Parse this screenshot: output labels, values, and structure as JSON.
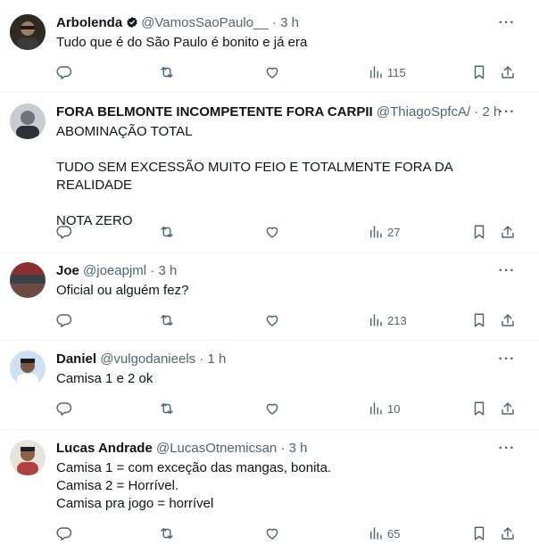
{
  "feed": {
    "tweets": [
      {
        "name": "Arbolenda",
        "verified": true,
        "handle": "@VamosSaoPaulo__",
        "separator": "·",
        "time": "3 h",
        "text": "Tudo que é do São Paulo é bonito e já era",
        "views": "115",
        "avatar_color": "#2f2a24"
      },
      {
        "name": "FORA BELMONTE INCOMPETENTE FORA CARPII",
        "verified": false,
        "handle": "@ThiagoSpfcA/",
        "separator": "·",
        "time": "2 h",
        "text": "ABOMINAÇÃO TOTAL\n\nTUDO SEM EXCESSÃO MUITO FEIO E TOTALMENTE FORA DA REALIDADE\n\nNOTA ZERO",
        "views": "27",
        "avatar_color": "#8a8f96"
      },
      {
        "name": "Joe",
        "verified": false,
        "handle": "@joeapjml",
        "separator": "·",
        "time": "3 h",
        "text": "Oficial ou alguém fez?",
        "views": "213",
        "avatar_color": "#6b4a44"
      },
      {
        "name": "Daniel",
        "verified": false,
        "handle": "@vulgodanieels",
        "separator": "·",
        "time": "1 h",
        "text": "Camisa 1 e 2 ok",
        "views": "10",
        "avatar_color": "#5a7fa8"
      },
      {
        "name": "Lucas Andrade",
        "verified": false,
        "handle": "@LucasOtnemicsan",
        "separator": "·",
        "time": "3 h",
        "text": "Camisa 1 = com exceção das mangas, bonita.\nCamisa 2 = Horrível.\nCamisa pra jogo = horrível",
        "views": "65",
        "avatar_color": "#b0413e"
      }
    ]
  },
  "icons": {
    "more": "more-icon",
    "reply": "reply-icon",
    "retweet": "retweet-icon",
    "like": "heart-icon",
    "views": "views-icon",
    "bookmark": "bookmark-icon",
    "share": "share-icon",
    "verified": "verified-badge-icon"
  },
  "colors": {
    "text": "#0f1419",
    "muted": "#536471",
    "divider": "#eff3f4"
  }
}
